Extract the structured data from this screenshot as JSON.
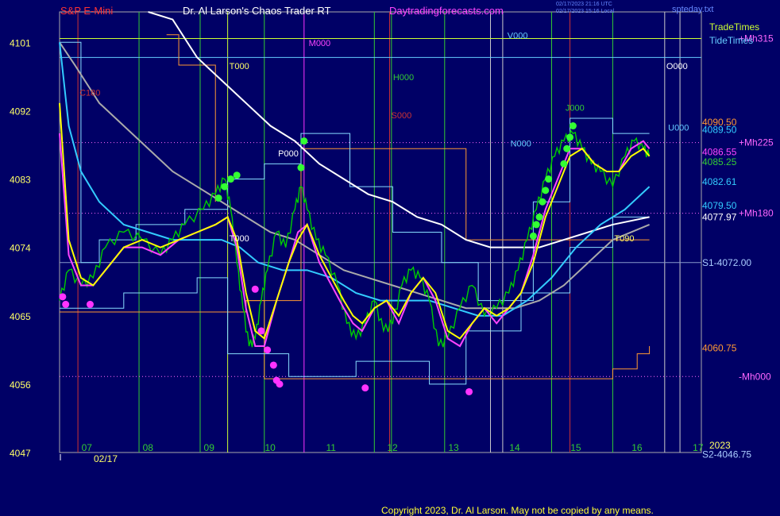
{
  "header": {
    "symbol": "S&P E-Mini",
    "app_title": "Dr. Al Larson's Chaos Trader RT",
    "site": "Daytradingforecasts.com",
    "stamp_line1": "02/17/2023 21:16 UTC",
    "stamp_line2": "02/17/2023 15:16 Local",
    "file": "spteday.txt"
  },
  "legend": {
    "trade_times": "TradeTimes",
    "tide_times": "TideTimes"
  },
  "footer": {
    "copyright": "Copyright 2023, Dr. Al Larson. May not be copied by any means."
  },
  "colors": {
    "background": "#000066",
    "price_bar": "#00cc00",
    "yellow_ma": "#ffff00",
    "magenta_ma": "#ff44ff",
    "cyan_ma": "#33ccff",
    "white_ma": "#ffffff",
    "gray_ma": "#aaaaaa",
    "tide_line": "#66ccff",
    "orange_line": "#ff9933",
    "trade_time": "#ccff33",
    "vertical_green": "#33cc33",
    "vertical_red": "#cc3333",
    "vertical_magenta": "#ff33ff",
    "high_dot": "#33ff33",
    "low_dot": "#ff33ff"
  },
  "chart_data": {
    "type": "line",
    "title": "S&P E-Mini",
    "ylim": [
      4047,
      4105
    ],
    "xlim": [
      6.55,
      17.05
    ],
    "y_ticks": [
      "4101",
      "4092",
      "4083",
      "4074",
      "4065",
      "4056",
      "4047"
    ],
    "x_ticks": [
      {
        "label": "07",
        "x": 7.0
      },
      {
        "label": "08",
        "x": 8.0
      },
      {
        "label": "09",
        "x": 9.0
      },
      {
        "label": "10",
        "x": 10.0
      },
      {
        "label": "11",
        "x": 11.0
      },
      {
        "label": "12",
        "x": 12.0
      },
      {
        "label": "13",
        "x": 13.0
      },
      {
        "label": "14",
        "x": 14.0
      },
      {
        "label": "15",
        "x": 15.0
      },
      {
        "label": "16",
        "x": 16.0
      },
      {
        "label": "17",
        "x": 17.0
      }
    ],
    "date_label": "02/17",
    "year_label": "2023",
    "price": {
      "x": [
        6.55,
        6.7,
        6.9,
        7.1,
        7.3,
        7.6,
        7.9,
        8.2,
        8.4,
        8.6,
        8.9,
        9.1,
        9.25,
        9.35,
        9.45,
        9.55,
        9.65,
        9.75,
        9.85,
        9.95,
        10.1,
        10.25,
        10.4,
        10.5,
        10.6,
        10.75,
        10.9,
        11.1,
        11.25,
        11.4,
        11.55,
        11.7,
        11.85,
        12.0,
        12.15,
        12.3,
        12.45,
        12.6,
        12.75,
        12.9,
        13.1,
        13.3,
        13.5,
        13.7,
        13.9,
        14.05,
        14.2,
        14.35,
        14.5,
        14.65,
        14.8,
        14.95,
        15.1,
        15.25,
        15.4,
        15.6,
        15.8,
        15.95,
        16.1,
        16.2
      ],
      "values": [
        4067,
        4071,
        4069,
        4070,
        4074,
        4076,
        4075,
        4073,
        4075,
        4077,
        4079,
        4081,
        4083,
        4079,
        4072,
        4066,
        4061,
        4062,
        4067,
        4071,
        4076,
        4074,
        4079,
        4082,
        4079,
        4075,
        4073,
        4069,
        4064,
        4062,
        4064,
        4067,
        4063,
        4064,
        4069,
        4071,
        4070,
        4067,
        4061,
        4062,
        4066,
        4069,
        4065,
        4066,
        4068,
        4071,
        4075,
        4079,
        4083,
        4086,
        4088,
        4089,
        4087,
        4085,
        4084,
        4082,
        4086,
        4088,
        4087,
        4086
      ]
    },
    "moving_averages": [
      {
        "color": "yellow",
        "x": [
          6.55,
          6.7,
          6.9,
          7.1,
          7.3,
          7.6,
          7.9,
          8.2,
          8.5,
          8.8,
          9.1,
          9.3,
          9.45,
          9.6,
          9.75,
          9.9,
          10.1,
          10.3,
          10.45,
          10.6,
          10.8,
          11.0,
          11.2,
          11.35,
          11.5,
          11.7,
          11.9,
          12.1,
          12.3,
          12.5,
          12.7,
          12.9,
          13.1,
          13.3,
          13.5,
          13.7,
          13.9,
          14.1,
          14.3,
          14.5,
          14.7,
          14.9,
          15.1,
          15.3,
          15.5,
          15.7,
          15.9,
          16.1,
          16.2
        ],
        "values": [
          4093,
          4075,
          4070,
          4069,
          4071,
          4074,
          4075,
          4074,
          4075,
          4076,
          4077,
          4078,
          4075,
          4068,
          4063,
          4062,
          4067,
          4072,
          4075,
          4077,
          4073,
          4070,
          4067,
          4065,
          4064,
          4066,
          4067,
          4065,
          4068,
          4070,
          4068,
          4063,
          4062,
          4064,
          4066,
          4065,
          4066,
          4068,
          4072,
          4078,
          4082,
          4086,
          4087,
          4085,
          4084,
          4084,
          4086,
          4087,
          4086
        ]
      },
      {
        "color": "magenta",
        "x": [
          6.55,
          6.7,
          6.9,
          7.1,
          7.3,
          7.6,
          7.9,
          8.2,
          8.5,
          8.8,
          9.1,
          9.3,
          9.45,
          9.6,
          9.75,
          9.9,
          10.1,
          10.3,
          10.45,
          10.6,
          10.8,
          11.0,
          11.2,
          11.35,
          11.5,
          11.7,
          11.9,
          12.1,
          12.3,
          12.5,
          12.7,
          12.9,
          13.1,
          13.3,
          13.5,
          13.7,
          13.9,
          14.1,
          14.3,
          14.5,
          14.7,
          14.9,
          15.1,
          15.3,
          15.5,
          15.7,
          15.9,
          16.1,
          16.2
        ],
        "values": [
          4089,
          4073,
          4069,
          4069,
          4071,
          4074,
          4074,
          4073,
          4075,
          4076,
          4077,
          4078,
          4074,
          4066,
          4061,
          4061,
          4067,
          4072,
          4076,
          4077,
          4072,
          4069,
          4066,
          4064,
          4063,
          4066,
          4067,
          4064,
          4068,
          4070,
          4067,
          4062,
          4061,
          4064,
          4066,
          4064,
          4066,
          4068,
          4073,
          4079,
          4083,
          4087,
          4087,
          4085,
          4084,
          4084,
          4087,
          4088,
          4087
        ]
      },
      {
        "color": "cyan",
        "x": [
          6.55,
          6.7,
          6.9,
          7.2,
          7.6,
          8.0,
          8.4,
          8.8,
          9.2,
          9.5,
          9.8,
          10.2,
          10.6,
          11.0,
          11.4,
          11.8,
          12.2,
          12.6,
          13.0,
          13.4,
          13.8,
          14.2,
          14.6,
          15.0,
          15.4,
          15.8,
          16.2
        ],
        "values": [
          4101,
          4090,
          4084,
          4080,
          4077,
          4076,
          4075,
          4075,
          4075,
          4074,
          4072,
          4071,
          4071,
          4070,
          4068,
          4067,
          4067,
          4067,
          4066,
          4065,
          4065,
          4067,
          4070,
          4074,
          4077,
          4079,
          4082
        ]
      },
      {
        "color": "gray",
        "x": [
          6.55,
          6.8,
          7.2,
          7.6,
          8.0,
          8.4,
          8.8,
          9.2,
          9.6,
          10.0,
          10.4,
          10.8,
          11.2,
          11.6,
          12.0,
          12.4,
          12.8,
          13.2,
          13.6,
          14.0,
          14.4,
          14.8,
          15.2,
          15.6,
          16.2
        ],
        "values": [
          4101,
          4098,
          4093,
          4090,
          4087,
          4084,
          4082,
          4080,
          4078,
          4076,
          4075,
          4073,
          4071,
          4070,
          4069,
          4068,
          4067,
          4066,
          4066,
          4066,
          4067,
          4069,
          4072,
          4075,
          4077
        ]
      },
      {
        "color": "white",
        "x": [
          8.0,
          8.4,
          8.8,
          9.2,
          9.6,
          10.0,
          10.4,
          10.8,
          11.2,
          11.6,
          12.0,
          12.4,
          12.8,
          13.2,
          13.6,
          14.0,
          14.4,
          14.8,
          15.2,
          15.6,
          16.2
        ],
        "values": [
          4110,
          4104,
          4099,
          4096,
          4093,
          4090,
          4088,
          4085,
          4083,
          4081,
          4080,
          4078,
          4077,
          4075,
          4074,
          4074,
          4074,
          4075,
          4076,
          4077,
          4078
        ]
      }
    ],
    "horizontal_lines": [
      {
        "y": 4072.0,
        "label": "S1-4072.00",
        "color": "#aaccff"
      },
      {
        "y": 4077.97,
        "label": "4077.97",
        "color": "#ffffff"
      },
      {
        "y": 4085.25,
        "label": "4085.25",
        "color": "#33cc33"
      },
      {
        "y": 4086.55,
        "label": "4086.55",
        "color": "#ff44ff"
      },
      {
        "y": 4082.61,
        "label": "4082.61",
        "color": "#33ccff"
      },
      {
        "y": 4079.5,
        "label": "4079.50",
        "color": "#33ccff"
      },
      {
        "y": 4089.5,
        "label": "4089.50",
        "color": "#33ccff"
      },
      {
        "y": 4090.5,
        "label": "4090.50",
        "color": "#ff9933"
      },
      {
        "y": 4060.75,
        "label": "4060.75",
        "color": "#ff9933"
      },
      {
        "y": 4046.75,
        "label": "S2-4046.75",
        "color": "#aaccff"
      }
    ],
    "electric_lines": [
      {
        "label": "+Mh315",
        "y": 4101.5
      },
      {
        "label": "+Mh225",
        "y": 4087.8
      },
      {
        "label": "+Mh180",
        "y": 4078.5
      },
      {
        "label": "-Mh000",
        "y": 4057.0
      }
    ],
    "vertical_lines": [
      {
        "x": 6.85,
        "color": "red"
      },
      {
        "x": 7.85,
        "color": "green"
      },
      {
        "x": 8.85,
        "color": "green"
      },
      {
        "x": 9.3,
        "color": "yellow"
      },
      {
        "x": 9.9,
        "color": "green"
      },
      {
        "x": 10.55,
        "color": "magenta"
      },
      {
        "x": 11.7,
        "color": "green"
      },
      {
        "x": 11.95,
        "color": "red"
      },
      {
        "x": 11.98,
        "color": "green"
      },
      {
        "x": 12.85,
        "color": "green"
      },
      {
        "x": 13.6,
        "color": "gray"
      },
      {
        "x": 13.8,
        "color": "gray"
      },
      {
        "x": 14.6,
        "color": "green"
      },
      {
        "x": 14.9,
        "color": "red"
      },
      {
        "x": 15.6,
        "color": "green"
      },
      {
        "x": 16.45,
        "color": "gray"
      },
      {
        "x": 16.7,
        "color": "gray"
      }
    ],
    "markers": [
      {
        "label": "C180",
        "x": 6.85,
        "y": 4094.0,
        "color": "#cc3333"
      },
      {
        "label": "T000",
        "x": 9.3,
        "y": 4097.5,
        "color": "#ffff66"
      },
      {
        "label": "M000",
        "x": 10.6,
        "y": 4100.5,
        "color": "#ff44ff"
      },
      {
        "label": "H000",
        "x": 11.98,
        "y": 4096.0,
        "color": "#33cc33"
      },
      {
        "label": "S000",
        "x": 11.95,
        "y": 4091.0,
        "color": "#cc3333"
      },
      {
        "label": "V000",
        "x": 13.85,
        "y": 4101.5,
        "color": "#66ccff"
      },
      {
        "label": "O000",
        "x": 16.45,
        "y": 4097.5,
        "color": "#ffffff"
      },
      {
        "label": "J000",
        "x": 14.8,
        "y": 4092.0,
        "color": "#33cc33"
      },
      {
        "label": "N000",
        "x": 13.9,
        "y": 4087.3,
        "color": "#66ccff"
      },
      {
        "label": "P000",
        "x": 10.1,
        "y": 4086.0,
        "color": "#ffffff"
      },
      {
        "label": "T000",
        "x": 9.3,
        "y": 4074.8,
        "color": "#ffffff"
      },
      {
        "label": "T090",
        "x": 15.6,
        "y": 4074.8,
        "color": "#ffff66"
      },
      {
        "label": "U000",
        "x": 16.48,
        "y": 4089.4,
        "color": "#66ccff"
      }
    ],
    "high_dots": [
      [
        9.15,
        4080.5
      ],
      [
        9.25,
        4082
      ],
      [
        9.35,
        4083
      ],
      [
        9.45,
        4083.5
      ],
      [
        10.5,
        4084.5
      ],
      [
        10.55,
        4088
      ],
      [
        14.3,
        4075.5
      ],
      [
        14.35,
        4077
      ],
      [
        14.4,
        4078
      ],
      [
        14.45,
        4080
      ],
      [
        14.5,
        4081.5
      ],
      [
        14.55,
        4083
      ],
      [
        14.8,
        4085
      ],
      [
        14.85,
        4087
      ],
      [
        14.9,
        4088.5
      ],
      [
        14.95,
        4090
      ]
    ],
    "low_dots": [
      [
        6.6,
        4067.5
      ],
      [
        6.65,
        4066.5
      ],
      [
        7.05,
        4066.5
      ],
      [
        9.75,
        4068.5
      ],
      [
        9.85,
        4063
      ],
      [
        9.95,
        4060.5
      ],
      [
        10.05,
        4058.5
      ],
      [
        10.1,
        4056.5
      ],
      [
        10.15,
        4056
      ],
      [
        11.55,
        4055.5
      ],
      [
        13.25,
        4055
      ]
    ]
  }
}
